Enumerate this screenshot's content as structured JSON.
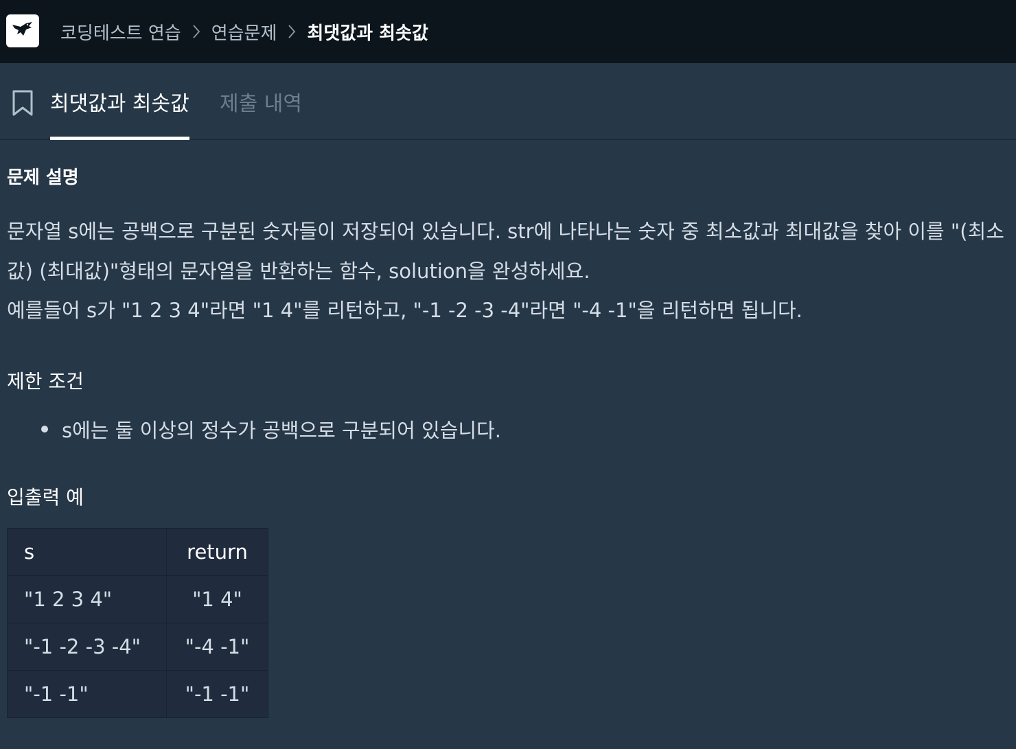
{
  "header": {
    "logo_icon": "hummingbird-logo-icon",
    "breadcrumbs": [
      "코딩테스트 연습",
      "연습문제",
      "최댓값과 최솟값"
    ],
    "separator_icon": "chevron-right-icon"
  },
  "tabs": {
    "bookmark_icon": "bookmark-icon",
    "items": [
      {
        "label": "최댓값과 최솟값",
        "active": true
      },
      {
        "label": "제출 내역",
        "active": false
      }
    ]
  },
  "problem": {
    "heading": "문제 설명",
    "description": [
      "문자열 s에는 공백으로 구분된 숫자들이 저장되어 있습니다. str에 나타나는 숫자 중 최소값과 최대값을 찾아 이를 \"(최소값) (최대값)\"형태의 문자열을 반환하는 함수, solution을 완성하세요.",
      "예를들어 s가 \"1 2 3 4\"라면 \"1 4\"를 리턴하고, \"-1 -2 -3 -4\"라면 \"-4 -1\"을 리턴하면 됩니다."
    ],
    "constraints_heading": "제한 조건",
    "constraints": [
      "s에는 둘 이상의 정수가 공백으로 구분되어 있습니다."
    ],
    "examples_heading": "입출력 예",
    "examples": {
      "columns": [
        "s",
        "return"
      ],
      "rows": [
        [
          "\"1 2 3 4\"",
          "\"1 4\""
        ],
        [
          "\"-1 -2 -3 -4\"",
          "\"-4 -1\""
        ],
        [
          "\"-1 -1\"",
          "\"-1 -1\""
        ]
      ]
    }
  },
  "colors": {
    "topbar_bg": "#0c151c",
    "page_bg": "#263747",
    "table_bg": "#202b3d",
    "text": "#d5dde6",
    "muted_tab": "#6b7f8f"
  }
}
